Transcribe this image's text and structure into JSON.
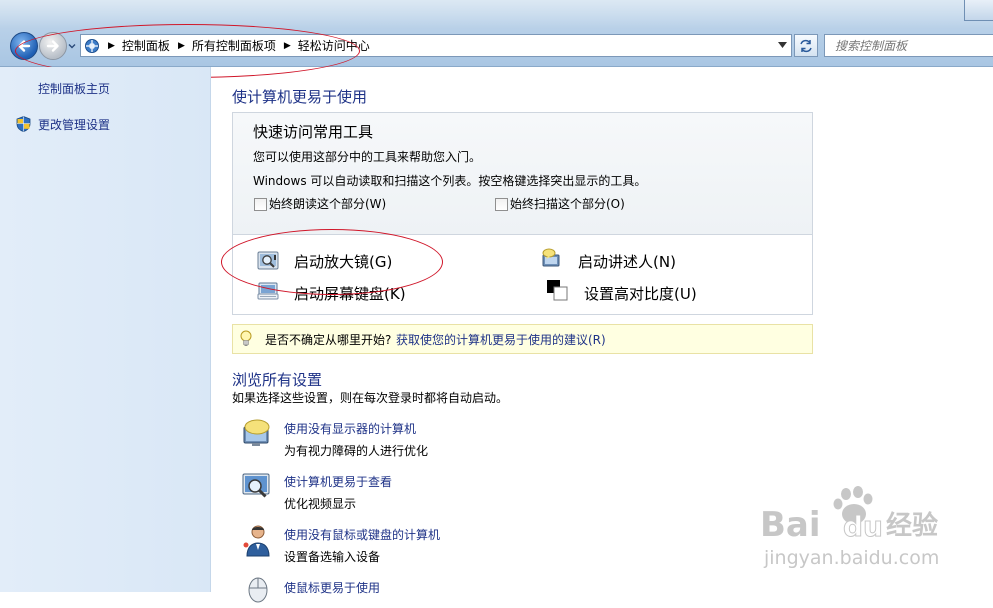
{
  "address": {
    "breadcrumbs": [
      "控制面板",
      "所有控制面板项",
      "轻松访问中心"
    ],
    "search_placeholder": "搜索控制面板"
  },
  "sidebar": {
    "home": "控制面板主页",
    "admin": "更改管理设置"
  },
  "main": {
    "heading": "使计算机更易于使用",
    "quick_tools": {
      "title": "快速访问常用工具",
      "line1": "您可以使用这部分中的工具来帮助您入门。",
      "line2": "Windows 可以自动读取和扫描这个列表。按空格键选择突出显示的工具。",
      "always_read": "始终朗读这个部分(W)",
      "always_scan": "始终扫描这个部分(O)",
      "magnifier": "启动放大镜(G)",
      "narrator": "启动讲述人(N)",
      "osk": "启动屏幕键盘(K)",
      "contrast": "设置高对比度(U)"
    },
    "tip": {
      "question": "是否不确定从哪里开始?",
      "link": "获取使您的计算机更易于使用的建议(R)"
    },
    "browse": {
      "heading": "浏览所有设置",
      "subtitle": "如果选择这些设置，则在每次登录时都将自动启动。",
      "items": [
        {
          "title": "使用没有显示器的计算机",
          "desc": "为有视力障碍的人进行优化"
        },
        {
          "title": "使计算机更易于查看",
          "desc": "优化视频显示"
        },
        {
          "title": "使用没有鼠标或键盘的计算机",
          "desc": "设置备选输入设备"
        },
        {
          "title": "使鼠标更易于使用",
          "desc": ""
        }
      ]
    }
  },
  "watermark": {
    "brand": "Baidu",
    "brand_cn": "经验",
    "url": "jingyan.baidu.com"
  },
  "colors": {
    "link": "#1e3287",
    "annotation": "#d0172a",
    "tip_bg": "#ffffe1"
  }
}
